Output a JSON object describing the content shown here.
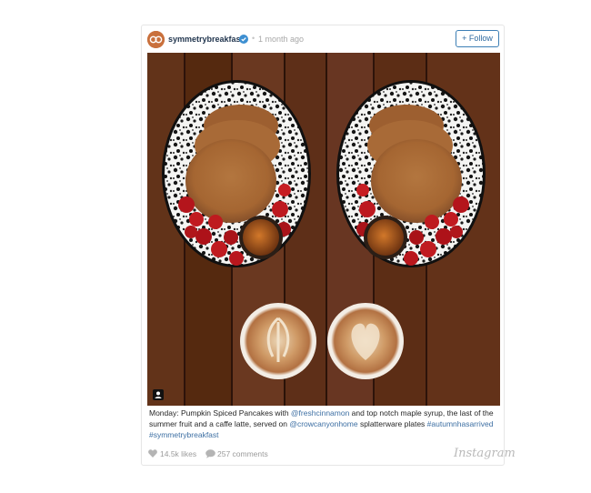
{
  "post": {
    "username": "symmetrybreakfast",
    "time": "1 month ago",
    "dot": "•",
    "follow_label": "+ Follow"
  },
  "caption": {
    "t1": "Monday: Pumpkin Spiced Pancakes with ",
    "m1": "@freshcinnamon",
    "t2": " and top notch maple syrup, the last of the summer fruit and a caffe latte, served on ",
    "m2": "@crowcanyonhome",
    "t3": " splatterware plates ",
    "h1": "#autumnhasarrived",
    "t4": " ",
    "h2": "#symmetrybreakfast"
  },
  "stats": {
    "likes": "14.5k likes",
    "comments": "257 comments"
  },
  "brand": "Instagram",
  "icons": [
    "avatar",
    "verified-icon",
    "user-tag-icon",
    "heart-icon",
    "comment-icon"
  ],
  "colors": {
    "link": "#3d6fa3",
    "follow_border": "#3d7fb5",
    "username": "#22364f"
  }
}
